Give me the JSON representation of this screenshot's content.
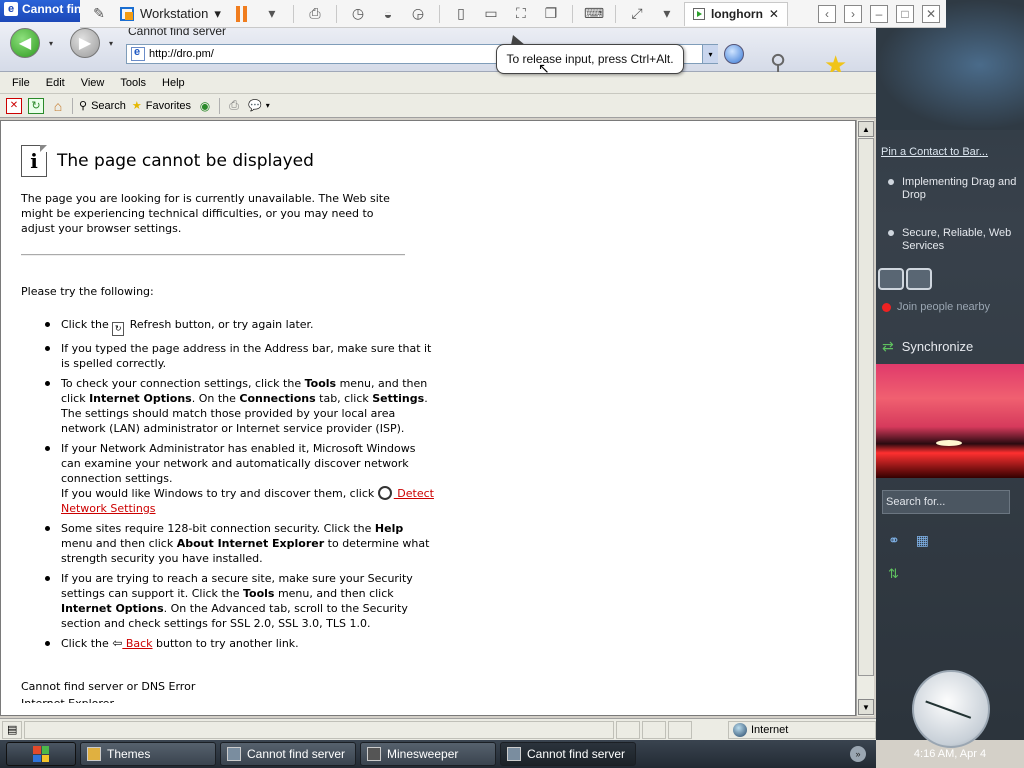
{
  "ie_window": {
    "title_fragment": "Cannot fin",
    "page_title": "Cannot find server",
    "address": "http://dro.pm/",
    "menu": [
      "File",
      "Edit",
      "View",
      "Tools",
      "Help"
    ],
    "toolbar": {
      "search": "Search",
      "favorites": "Favorites"
    }
  },
  "vm_toolbar": {
    "workstation_label": "Workstation",
    "tab_label": "longhorn",
    "tooltip": "To release input, press Ctrl+Alt."
  },
  "page": {
    "heading": "The page cannot be displayed",
    "intro": "The page you are looking for is currently unavailable. The Web site might be experiencing technical difficulties, or you may need to adjust your browser settings.",
    "try_heading": "Please try the following:",
    "tip1_a": "Click the ",
    "tip1_b": " Refresh button, or try again later.",
    "tip2": "If you typed the page address in the Address bar, make sure that it is spelled correctly.",
    "tip3_a": "To check your connection settings, click the ",
    "tip3_tools": "Tools",
    "tip3_b": " menu, and then click ",
    "tip3_io": "Internet Options",
    "tip3_c": ". On the ",
    "tip3_conn": "Connections",
    "tip3_d": " tab, click ",
    "tip3_settings": "Settings",
    "tip3_e": ". The settings should match those provided by your local area network (LAN) administrator or Internet service provider (ISP).",
    "tip4_a": "If your Network Administrator has enabled it, Microsoft Windows can examine your network and automatically discover network connection settings.",
    "tip4_b": "If you would like Windows to try and discover them, click ",
    "tip4_link": " Detect Network Settings",
    "tip5_a": "Some sites require 128-bit connection security. Click the ",
    "tip5_help": "Help",
    "tip5_b": " menu and then click ",
    "tip5_about": "About Internet Explorer",
    "tip5_c": " to determine what strength security you have installed.",
    "tip6_a": "If you are trying to reach a secure site, make sure your Security settings can support it. Click the ",
    "tip6_tools": "Tools",
    "tip6_b": " menu, and then click ",
    "tip6_io": "Internet Options",
    "tip6_c": ". On the Advanced tab, scroll to the Security section and check settings for SSL 2.0, SSL 3.0, TLS 1.0.",
    "tip7_a": "Click the ",
    "tip7_link": " Back",
    "tip7_b": " button to try another link.",
    "dns_error": "Cannot find server or DNS Error",
    "footer_cut": "Internet Explorer"
  },
  "status_bar": {
    "zone": "Internet"
  },
  "sidebar": {
    "pin_link": "Pin a Contact to Bar...",
    "item1": "Implementing Drag and Drop",
    "item2": "Secure, Reliable, Web Services",
    "join": "Join people nearby",
    "sync": "Synchronize",
    "search_placeholder": "Search for...",
    "time": "4:16 AM, Apr 4"
  },
  "taskbar": {
    "items": [
      "Themes",
      "Cannot find server",
      "Minesweeper",
      "Cannot find server"
    ]
  }
}
